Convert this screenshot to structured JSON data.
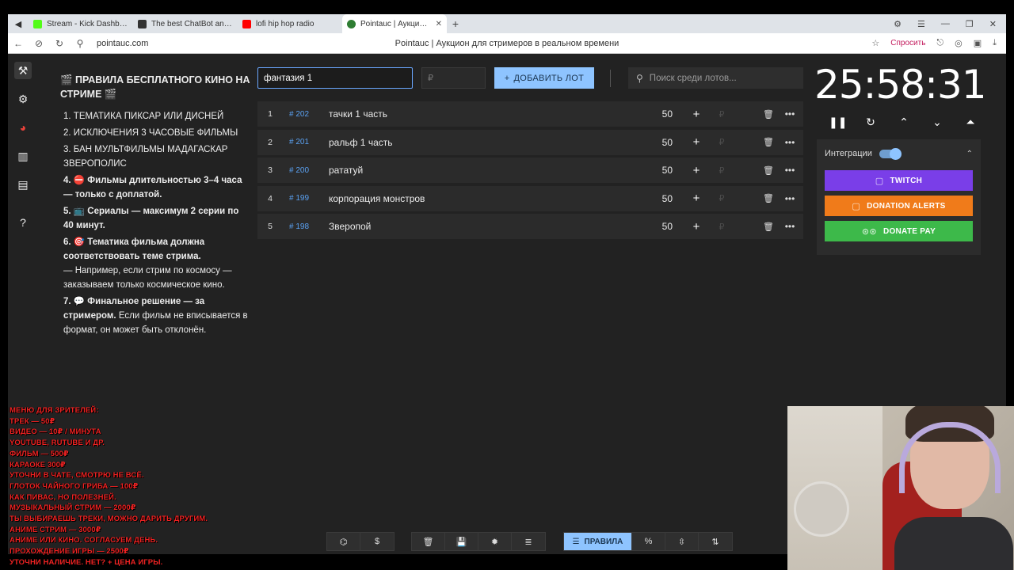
{
  "browser": {
    "tabs": [
      {
        "title": "Stream - Kick Dashboard",
        "favicon_color": "#53fc18"
      },
      {
        "title": "The best ChatBot and Wid",
        "favicon_color": "#333333"
      },
      {
        "title": "lofi hip hop radio",
        "favicon_color": "#ff0000"
      },
      {
        "title": "Pointauc | Аукцион для",
        "favicon_color": "#2e7d32"
      }
    ],
    "url": "pointauc.com",
    "page_title": "Pointauc | Аукцион для стримеров в реальном времени",
    "ask_label": "Спросить"
  },
  "rules": {
    "title": "🎬 ПРАВИЛА БЕСПЛАТНОГО КИНО НА СТРИМЕ 🎬",
    "items": [
      {
        "n": "1.",
        "text": "ТЕМАТИКА ПИКСАР ИЛИ ДИСНЕЙ",
        "bold": false
      },
      {
        "n": "2.",
        "text": "ИСКЛЮЧЕНИЯ  3 ЧАСОВЫЕ ФИЛЬМЫ",
        "bold": false
      },
      {
        "n": "3.",
        "text": "БАН МУЛЬТФИЛЬМЫ МАДАГАСКАР ЗВЕРОПОЛИС",
        "bold": false
      },
      {
        "n": "4.",
        "text": "⛔ Фильмы длительностью 3–4 часа — только с доплатой.",
        "bold": true
      },
      {
        "n": "5.",
        "text": "📺 Сериалы — максимум 2 серии по 40 минут.",
        "bold": true
      },
      {
        "n": "6.",
        "text": "🎯 Тематика фильма должна соответствовать теме стрима.",
        "bold": true,
        "extra": "— Например, если стрим по космосу — заказываем только космическое кино."
      },
      {
        "n": "7.",
        "text": "💬 Финальное решение — за стримером.",
        "bold": true,
        "extra": "Если фильм не вписывается в формат, он может быть отклонён."
      }
    ]
  },
  "controls": {
    "lot_name_value": "фантазия 1",
    "price_placeholder": "₽",
    "add_label": "ДОБАВИТЬ ЛОТ",
    "search_placeholder": "Поиск среди лотов..."
  },
  "lots": [
    {
      "num": "1",
      "id": "# 202",
      "name": "тачки 1 часть",
      "amount": "50"
    },
    {
      "num": "2",
      "id": "# 201",
      "name": "ральф 1 часть",
      "amount": "50"
    },
    {
      "num": "3",
      "id": "# 200",
      "name": "рататуй",
      "amount": "50"
    },
    {
      "num": "4",
      "id": "# 199",
      "name": "корпорация монстров",
      "amount": "50"
    },
    {
      "num": "5",
      "id": "# 198",
      "name": "Зверопой",
      "amount": "50"
    }
  ],
  "timer": {
    "value": "25:58:31"
  },
  "integrations": {
    "label": "Интеграции",
    "enabled": true,
    "twitch": "TWITCH",
    "donation_alerts": "DONATION ALERTS",
    "donate_pay": "DONATE PAY",
    "colors": {
      "twitch": "#7a3ee8",
      "donation_alerts": "#f07b1a",
      "donate_pay": "#3db94a"
    }
  },
  "overlay_menu": [
    "МЕНЮ ДЛЯ ЗРИТЕЛЕЙ:",
    "ТРЕК — 50₽",
    "ВИДЕО — 10₽ / МИНУТА",
    "YOUTUBE, RUTUBE И ДР.",
    "ФИЛЬМ — 500₽",
    "КАРАОКЕ 300₽",
    "УТОЧНИ В ЧАТЕ, СМОТРЮ НЕ ВСЁ.",
    "ГЛОТОК ЧАЙНОГО ГРИБА — 100₽",
    "КАК ПИВАС, НО ПОЛЕЗНЕЙ.",
    "МУЗЫКАЛЬНЫЙ СТРИМ — 2000₽",
    "ТЫ ВЫБИРАЕШЬ ТРЕКИ, МОЖНО ДАРИТЬ ДРУГИМ.",
    "АНИМЕ СТРИМ — 3000₽",
    "АНИМЕ ИЛИ КИНО. СОГЛАСУЕМ ДЕНЬ.",
    "ПРОХОЖДЕНИЕ ИГРЫ — 2500₽",
    "УТОЧНИ НАЛИЧИЕ. НЕТ? + ЦЕНА ИГРЫ."
  ],
  "toolbar": {
    "rules_label": "ПРАВИЛА"
  },
  "accent_color": "#8ec4ff"
}
